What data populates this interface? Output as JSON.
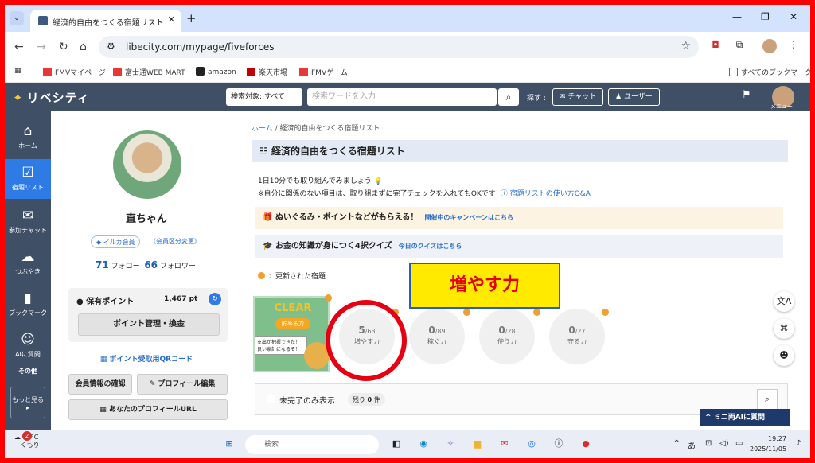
{
  "browser": {
    "tab_title": "経済的自由をつくる宿題リスト | リ",
    "url": "libecity.com/mypage/fiveforces",
    "bookmarks": [
      "FMVマイページ",
      "富士通WEB MART",
      "amazon",
      "楽天市場",
      "FMVゲーム"
    ],
    "all_bookmarks": "すべてのブックマーク"
  },
  "site": {
    "logo": "リベシティ",
    "search_scope": "検索対象: すべて",
    "search_placeholder": "検索ワードを入力",
    "sagasu": "探す :",
    "chat_btn": "チャット",
    "user_btn": "ユーザー",
    "menu_label": "メニュー"
  },
  "leftnav": [
    {
      "icon": "⌂",
      "label": "ホーム"
    },
    {
      "icon": "☑",
      "label": "宿題リスト"
    },
    {
      "icon": "✉",
      "label": "参加チャット"
    },
    {
      "icon": "☁",
      "label": "つぶやき"
    },
    {
      "icon": "▮",
      "label": "ブックマーク"
    },
    {
      "icon": "☺",
      "label": "AIに質問"
    },
    {
      "icon": "",
      "label": "その他"
    },
    {
      "icon": "",
      "label": "もっと見る ▸"
    }
  ],
  "profile": {
    "name": "直ちゃん",
    "member_type": "イルカ会員",
    "change_type": "（会員区分変更）",
    "follow_count": "71",
    "follow_label": "フォロー",
    "follower_count": "66",
    "follower_label": "フォロワー",
    "points_label": "保有ポイント",
    "points_value": "1,467 pt",
    "points_btn": "ポイント管理・換金",
    "qr_link": "ポイント受取用QRコード",
    "btn_member_info": "会員情報の確認",
    "btn_edit_profile": "プロフィール編集",
    "btn_profile_url": "あなたのプロフィールURL"
  },
  "main": {
    "breadcrumb_home": "ホーム",
    "breadcrumb_sep": "/",
    "breadcrumb_current": "経済的自由をつくる宿題リスト",
    "title": "経済的自由をつくる宿題リスト",
    "intro1": "1日10分でも取り組んでみましょう",
    "intro2": "※自分に関係のない項目は、取り組まずに完了チェックを入れてもOKです",
    "intro2_link": "宿題リストの使い方Q&A",
    "promo1": "ぬいぐるみ・ポイントなどがもらえる！",
    "promo1_link": "開催中のキャンペーンはこちら",
    "promo2": "お金の知識が身につく4択クイズ",
    "promo2_link": "今日のクイズはこちら",
    "legend": "：更新された宿題",
    "clear_title": "CLEAR",
    "clear_sub": "貯める力",
    "clear_note": "支出が把握できた！\n良い家計になるぞ！",
    "tiles": [
      {
        "done": "5",
        "total": "/63",
        "name": "増やす力"
      },
      {
        "done": "0",
        "total": "/89",
        "name": "稼ぐ力"
      },
      {
        "done": "0",
        "total": "/28",
        "name": "使う力"
      },
      {
        "done": "0",
        "total": "/27",
        "name": "守る力"
      }
    ],
    "callout": "増やす力",
    "filter_label": "未完了のみ表示",
    "remaining_label": "残り",
    "remaining_count": "0",
    "remaining_unit": "件",
    "mini_ai": "ミニ両AIに質問"
  },
  "taskbar": {
    "temp": "13°C",
    "weather": "くもり",
    "badge": "2",
    "search": "検索",
    "time": "19:27",
    "date": "2025/11/05",
    "ime": "あ"
  },
  "colors": {
    "header": "#3e4f66",
    "active_nav": "#2f7be5",
    "highlight_ring": "#e60012",
    "callout_bg": "#ffea00",
    "update_dot": "#f0a030"
  }
}
